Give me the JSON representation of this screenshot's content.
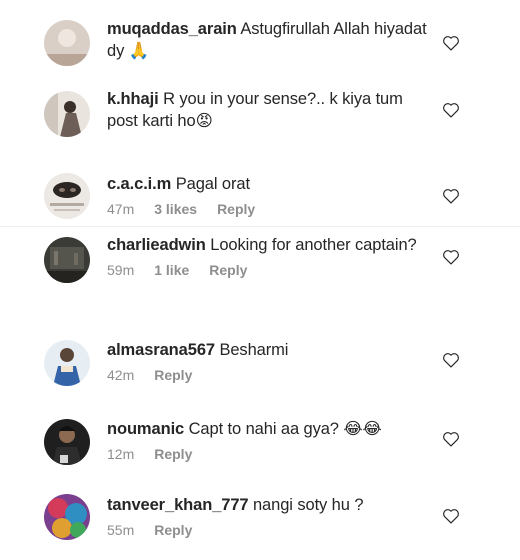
{
  "comments": [
    {
      "username": "muqaddas_arain",
      "text": "Astugfirullah Allah hiyadat dy",
      "emoji": "🙏",
      "time": "",
      "likes": "",
      "reply": ""
    },
    {
      "username": "k.hhaji",
      "text": "R you in your sense?.. k kiya tum post karti ho",
      "emoji": "😡",
      "time": "",
      "likes": "",
      "reply": ""
    },
    {
      "username": "c.a.c.i.m",
      "text": "Pagal orat",
      "emoji": "",
      "time": "47m",
      "likes": "3 likes",
      "reply": "Reply"
    },
    {
      "username": "charlieadwin",
      "text": "Looking for another captain?",
      "emoji": "",
      "time": "59m",
      "likes": "1 like",
      "reply": "Reply"
    },
    {
      "username": "almasrana567",
      "text": "Besharmi",
      "emoji": "",
      "time": "42m",
      "likes": "",
      "reply": "Reply"
    },
    {
      "username": "noumanic",
      "text": "Capt to nahi aa gya?",
      "emoji": "😂😂",
      "time": "12m",
      "likes": "",
      "reply": "Reply"
    },
    {
      "username": "tanveer_khan_777",
      "text": "nangi soty hu ?",
      "emoji": "",
      "time": "55m",
      "likes": "",
      "reply": "Reply"
    }
  ],
  "icons": {
    "like": "heart-outline-icon"
  },
  "colors": {
    "text": "#262626",
    "meta": "#8e8e8e",
    "heart": "#262626"
  }
}
